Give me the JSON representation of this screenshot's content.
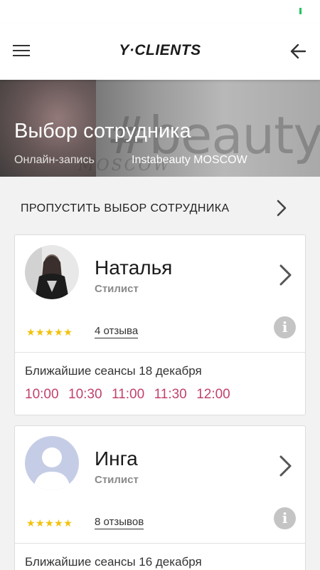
{
  "header": {
    "logo": "Y·CLIENTS"
  },
  "hero": {
    "title": "Выбор сотрудника",
    "subtitle": "Онлайн-запись",
    "salon": "Instabeauty MOSCOW"
  },
  "skip": {
    "label": "ПРОПУСТИТЬ ВЫБОР СОТРУДНИКА"
  },
  "staff": [
    {
      "name": "Наталья",
      "role": "Стилист",
      "rating": 5,
      "stars": "★★★★★",
      "reviews": "4 отзыва",
      "sessions": "Ближайшие сеансы 18 декабря",
      "times": [
        "10:00",
        "10:30",
        "11:00",
        "11:30",
        "12:00"
      ]
    },
    {
      "name": "Инга",
      "role": "Стилист",
      "rating": 5,
      "stars": "★★★★★",
      "reviews": "8 отзывов",
      "sessions": "Ближайшие сеансы 16 декабря"
    }
  ],
  "colors": {
    "time_slot": "#c2416e",
    "star": "#f2c20b",
    "status_signal": "#22c55e"
  }
}
